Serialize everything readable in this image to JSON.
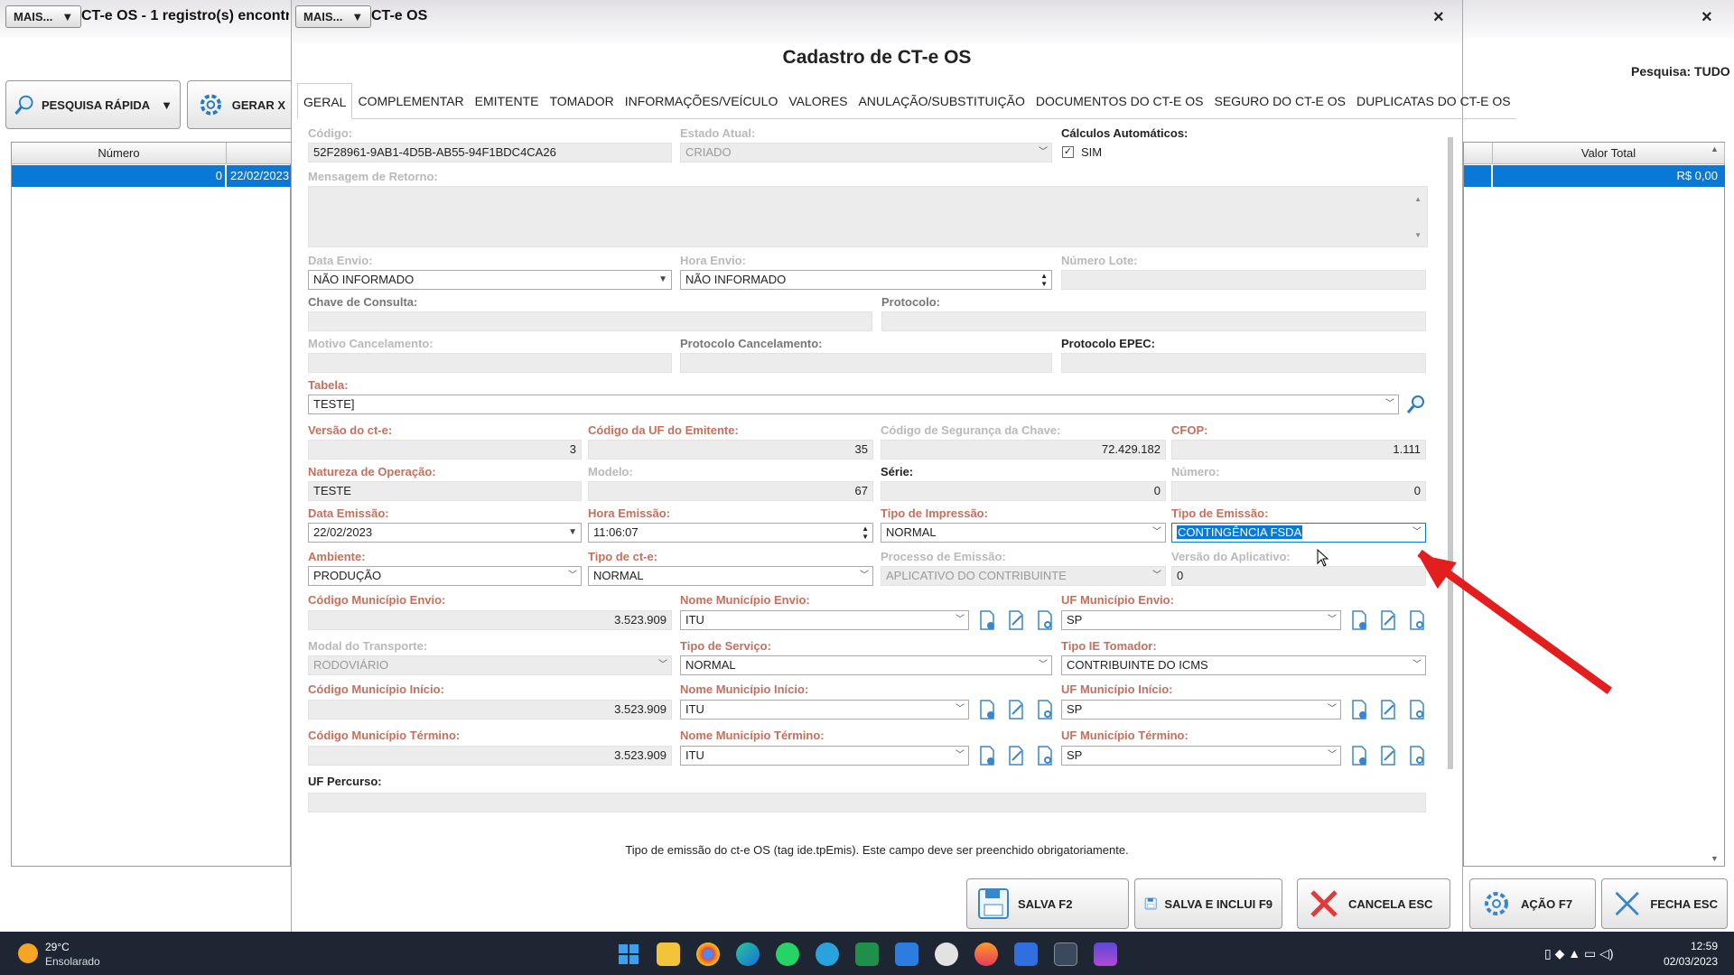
{
  "background_window": {
    "more_label": "MAIS...",
    "title": "CT-e OS - 1 registro(s) encontr",
    "close": "×",
    "search_label": "Pesquisa: TUDO",
    "quick_search": "PESQUISA RÁPIDA",
    "generate": "GERAR X",
    "grid_headers": [
      "Número",
      "Valor Total"
    ],
    "grid_row": {
      "numero": "0",
      "data": "22/02/2023",
      "valor_total": "R$ 0,00"
    }
  },
  "modal": {
    "more_label": "MAIS...",
    "window_title": "CT-e OS",
    "close": "×",
    "title": "Cadastro de CT-e OS",
    "tabs": [
      "GERAL",
      "COMPLEMENTAR",
      "EMITENTE",
      "TOMADOR",
      "INFORMAÇÕES/VEÍCULO",
      "VALORES",
      "ANULAÇÃO/SUBSTITUIÇÃO",
      "DOCUMENTOS DO CT-E OS",
      "SEGURO DO CT-E OS",
      "DUPLICATAS DO CT-E OS"
    ],
    "fields": {
      "codigo": {
        "label": "Código:",
        "value": "52F28961-9AB1-4D5B-AB55-94F1BDC4CA26"
      },
      "estado_atual": {
        "label": "Estado Atual:",
        "value": "CRIADO"
      },
      "calculos": {
        "label": "Cálculos Automáticos:",
        "value": "SIM"
      },
      "mensagem_retorno": {
        "label": "Mensagem de Retorno:"
      },
      "data_envio": {
        "label": "Data Envio:",
        "value": "NÃO INFORMADO"
      },
      "hora_envio": {
        "label": "Hora Envio:",
        "value": "NÃO INFORMADO"
      },
      "numero_lote": {
        "label": "Número Lote:"
      },
      "chave_consulta": {
        "label": "Chave de Consulta:"
      },
      "protocolo": {
        "label": "Protocolo:"
      },
      "motivo_cancelamento": {
        "label": "Motivo Cancelamento:"
      },
      "protocolo_cancelamento": {
        "label": "Protocolo Cancelamento:"
      },
      "protocolo_epec": {
        "label": "Protocolo EPEC:"
      },
      "tabela": {
        "label": "Tabela:",
        "value": "TESTE]"
      },
      "versao_cte": {
        "label": "Versão do ct-e:",
        "value": "3"
      },
      "codigo_uf_emitente": {
        "label": "Código da UF do Emitente:",
        "value": "35"
      },
      "codigo_seguranca": {
        "label": "Código de Segurança da Chave:",
        "value": "72.429.182"
      },
      "cfop": {
        "label": "CFOP:",
        "value": "1.111"
      },
      "natureza_operacao": {
        "label": "Natureza de Operação:",
        "value": "TESTE"
      },
      "modelo": {
        "label": "Modelo:",
        "value": "67"
      },
      "serie": {
        "label": "Série:",
        "value": "0"
      },
      "numero": {
        "label": "Número:",
        "value": "0"
      },
      "data_emissao": {
        "label": "Data Emissão:",
        "value": "22/02/2023"
      },
      "hora_emissao": {
        "label": "Hora Emissão:",
        "value": "11:06:07"
      },
      "tipo_impressao": {
        "label": "Tipo de Impressão:",
        "value": "NORMAL"
      },
      "tipo_emissao": {
        "label": "Tipo de Emissão:",
        "value": "CONTINGÊNCIA FSDA"
      },
      "ambiente": {
        "label": "Ambiente:",
        "value": "PRODUÇÃO"
      },
      "tipo_cte": {
        "label": "Tipo de ct-e:",
        "value": "NORMAL"
      },
      "processo_emissao": {
        "label": "Processo de Emissão:",
        "value": "APLICATIVO DO CONTRIBUINTE"
      },
      "versao_aplicativo": {
        "label": "Versão do Aplicativo:",
        "value": "0"
      },
      "cod_mun_envio": {
        "label": "Código Município Envio:",
        "value": "3.523.909"
      },
      "nome_mun_envio": {
        "label": "Nome Município Envio:",
        "value": "ITU"
      },
      "uf_mun_envio": {
        "label": "UF Município Envio:",
        "value": "SP"
      },
      "modal_transporte": {
        "label": "Modal do Transporte:",
        "value": "RODOVIÁRIO"
      },
      "tipo_servico": {
        "label": "Tipo de Serviço:",
        "value": "NORMAL"
      },
      "tipo_ie_tomador": {
        "label": "Tipo IE Tomador:",
        "value": "CONTRIBUINTE DO ICMS"
      },
      "cod_mun_inicio": {
        "label": "Código Município Início:",
        "value": "3.523.909"
      },
      "nome_mun_inicio": {
        "label": "Nome Município Início:",
        "value": "ITU"
      },
      "uf_mun_inicio": {
        "label": "UF Município Início:",
        "value": "SP"
      },
      "cod_mun_termino": {
        "label": "Código Município Término:",
        "value": "3.523.909"
      },
      "nome_mun_termino": {
        "label": "Nome Município Término:",
        "value": "ITU"
      },
      "uf_mun_termino": {
        "label": "UF Município Término:",
        "value": "SP"
      },
      "uf_percurso": {
        "label": "UF Percurso:"
      }
    },
    "hint": "Tipo de emissão do ct-e OS (tag ide.tpEmis). Este campo deve ser preenchido obrigatoriamente.",
    "buttons": {
      "salva": "SALVA F2",
      "salva_inclui": "SALVA E INCLUI F9",
      "cancela": "CANCELA ESC"
    }
  },
  "outer_buttons": {
    "acao": "AÇÃO F7",
    "fecha": "FECHA ESC"
  },
  "taskbar": {
    "temperature": "29°C",
    "weather": "Ensolarado",
    "time": "12:59",
    "date": "02/03/2023"
  },
  "colors": {
    "accent": "#0a78d7",
    "required_label": "#c4705d",
    "disabled_label": "#b9b9b9",
    "annotation_arrow": "#e21e1e"
  }
}
